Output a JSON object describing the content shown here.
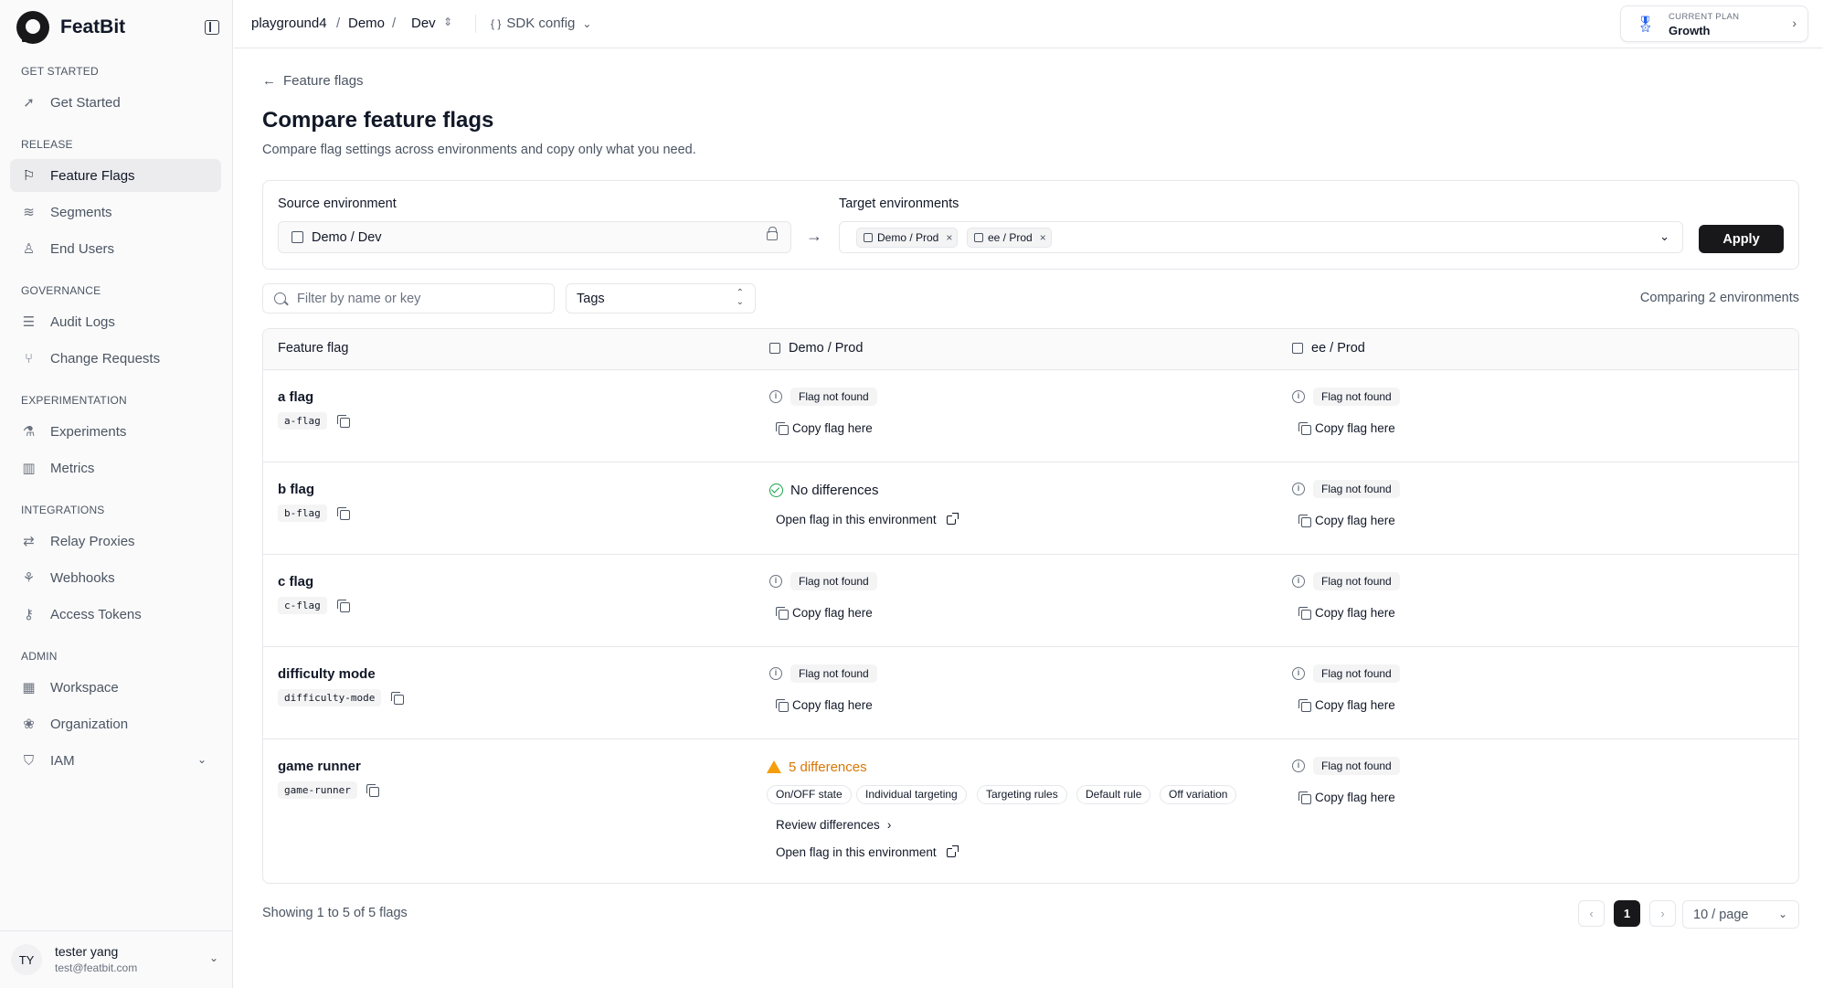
{
  "app": {
    "name": "FeatBit"
  },
  "sidebar": {
    "sections": [
      {
        "title": "GET STARTED",
        "items": [
          {
            "label": "Get Started",
            "icon": "rocket-icon"
          }
        ]
      },
      {
        "title": "RELEASE",
        "items": [
          {
            "label": "Feature Flags",
            "icon": "flag-icon",
            "active": true
          },
          {
            "label": "Segments",
            "icon": "layers-icon"
          },
          {
            "label": "End Users",
            "icon": "user-icon"
          }
        ]
      },
      {
        "title": "GOVERNANCE",
        "items": [
          {
            "label": "Audit Logs",
            "icon": "list-icon"
          },
          {
            "label": "Change Requests",
            "icon": "git-pull-request-icon"
          }
        ]
      },
      {
        "title": "EXPERIMENTATION",
        "items": [
          {
            "label": "Experiments",
            "icon": "flask-icon"
          },
          {
            "label": "Metrics",
            "icon": "bar-chart-icon"
          }
        ]
      },
      {
        "title": "INTEGRATIONS",
        "items": [
          {
            "label": "Relay Proxies",
            "icon": "relay-icon"
          },
          {
            "label": "Webhooks",
            "icon": "webhook-icon"
          },
          {
            "label": "Access Tokens",
            "icon": "key-icon"
          }
        ]
      },
      {
        "title": "ADMIN",
        "items": [
          {
            "label": "Workspace",
            "icon": "building-icon"
          },
          {
            "label": "Organization",
            "icon": "organization-icon"
          },
          {
            "label": "IAM",
            "icon": "shield-icon",
            "expandable": true
          }
        ]
      }
    ]
  },
  "user": {
    "initials": "TY",
    "name": "tester yang",
    "email": "test@featbit.com"
  },
  "topbar": {
    "project": "playground4",
    "sep1": "/",
    "env_group": "Demo",
    "sep2": "/",
    "env": "Dev",
    "sdk_config": "SDK config",
    "plan_label": "CURRENT PLAN",
    "plan_value": "Growth"
  },
  "page": {
    "back_label": "Feature flags",
    "title": "Compare feature flags",
    "subtitle": "Compare flag settings across environments and copy only what you need."
  },
  "compare": {
    "source_label": "Source environment",
    "source_value": "Demo / Dev",
    "target_label": "Target environments",
    "targets": [
      "Demo / Prod",
      "ee / Prod"
    ],
    "apply_label": "Apply"
  },
  "filters": {
    "search_placeholder": "Filter by name or key",
    "tags_label": "Tags",
    "comparing_text": "Comparing 2 environments"
  },
  "table": {
    "headers": [
      "Feature flag",
      "Demo / Prod",
      "ee / Prod"
    ],
    "texts": {
      "not_found": "Flag not found",
      "copy_here": "Copy flag here",
      "no_differences": "No differences",
      "open_flag": "Open flag in this environment",
      "review_differences": "Review differences"
    },
    "rows": [
      {
        "name": "a flag",
        "key": "a-flag"
      },
      {
        "name": "b flag",
        "key": "b-flag"
      },
      {
        "name": "c flag",
        "key": "c-flag"
      },
      {
        "name": "difficulty mode",
        "key": "difficulty-mode"
      },
      {
        "name": "game runner",
        "key": "game-runner",
        "differences_label": "5 differences",
        "diff_tags": [
          "On/OFF state",
          "Individual targeting",
          "Targeting rules",
          "Default rule",
          "Off variation"
        ]
      }
    ]
  },
  "pagination": {
    "summary": "Showing 1 to 5 of 5 flags",
    "prev": "‹",
    "current_page": "1",
    "next": "›",
    "page_size": "10 / page"
  },
  "colors": {
    "accent": "#18181b",
    "warning": "#d97706",
    "success": "#16a34a",
    "plan_icon": "#2563eb"
  }
}
